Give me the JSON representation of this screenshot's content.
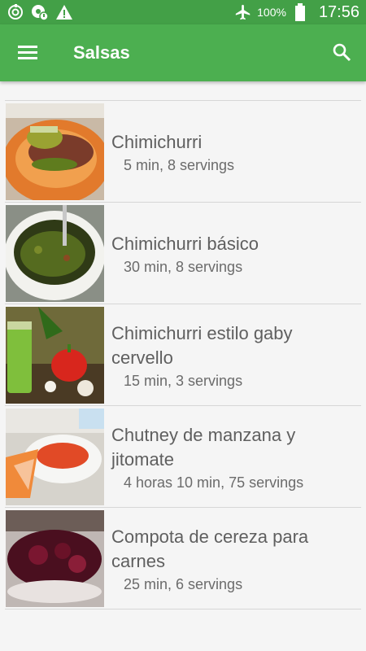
{
  "status_bar": {
    "left_icons": [
      "sync-icon",
      "app-notification-icon",
      "warning-icon"
    ],
    "right_icons": [
      "airplane-mode-icon",
      "battery-icon"
    ],
    "battery": "100%",
    "time": "17:56"
  },
  "app_bar": {
    "menu_icon": "hamburger-menu-icon",
    "title": "Salsas",
    "search_icon": "search-icon"
  },
  "recipes": [
    {
      "title": "Chimichurri",
      "meta": "5 min, 8 servings"
    },
    {
      "title": "Chimichurri básico",
      "meta": "30 min, 8 servings"
    },
    {
      "title": "Chimichurri estilo gaby cervello",
      "meta": "15 min, 3 servings"
    },
    {
      "title": "Chutney de manzana y jitomate",
      "meta": "4 horas 10 min, 75 servings"
    },
    {
      "title": "Compota de cereza para carnes",
      "meta": "25 min, 6 servings"
    }
  ],
  "colors": {
    "status_bar": "#43a047",
    "app_bar": "#4caf50",
    "background": "#f5f5f5",
    "text_primary": "#5f5f5f"
  }
}
